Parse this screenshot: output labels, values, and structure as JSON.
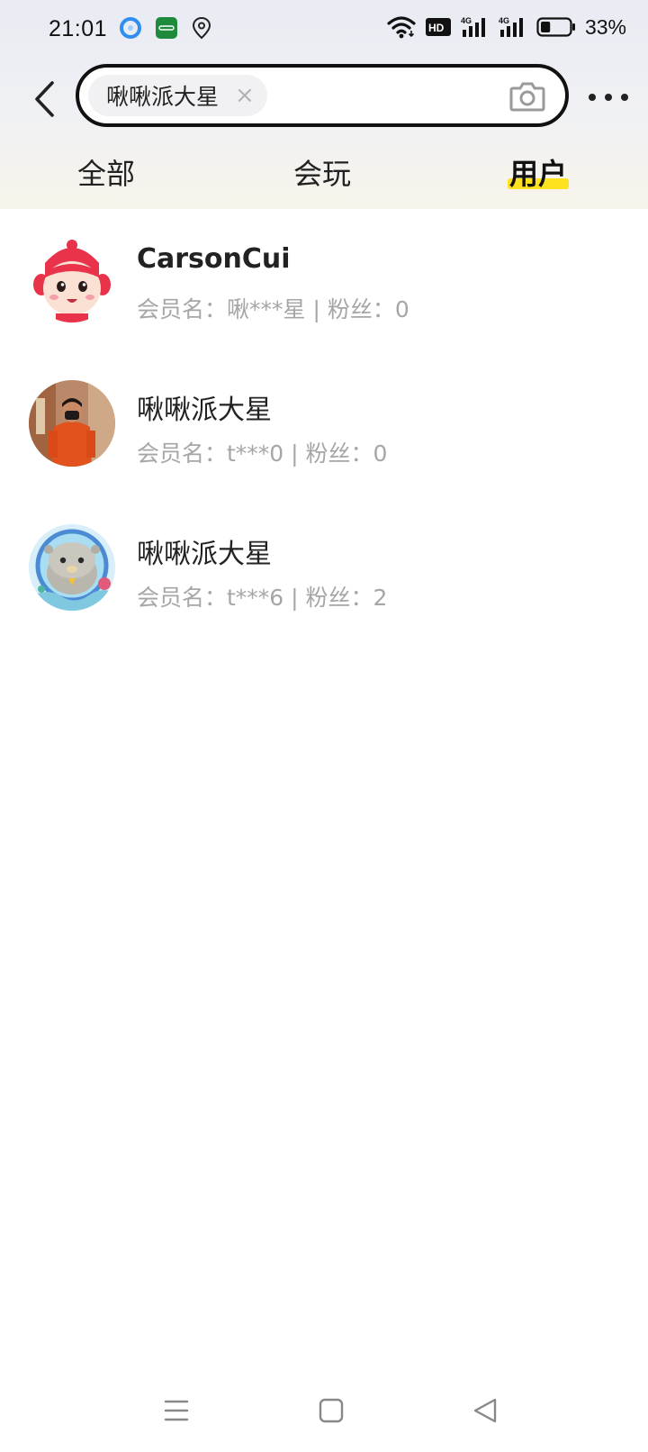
{
  "status_bar": {
    "time": "21:01",
    "battery_percent": "33%",
    "battery_level": 0.33,
    "network_badges": [
      "HD",
      "4G",
      "4G"
    ]
  },
  "search": {
    "query": "啾啾派大星",
    "clear_icon": "×"
  },
  "tabs": [
    {
      "label": "全部",
      "active": false
    },
    {
      "label": "会玩",
      "active": false
    },
    {
      "label": "用户",
      "active": true
    }
  ],
  "users": [
    {
      "name": "CarsonCui",
      "meta": "会员名：啾***星 | 粉丝：0",
      "avatar": "cartoon-monkey"
    },
    {
      "name": "啾啾派大星",
      "meta": "会员名：t***0 | 粉丝：0",
      "avatar": "person-photo"
    },
    {
      "name": "啾啾派大星",
      "meta": "会员名：t***6 | 粉丝：2",
      "avatar": "seal-cartoon"
    }
  ],
  "colors": {
    "active_tab_underline": "#ffe21f",
    "meta_text": "#a6a6a6",
    "search_border": "#111111"
  }
}
